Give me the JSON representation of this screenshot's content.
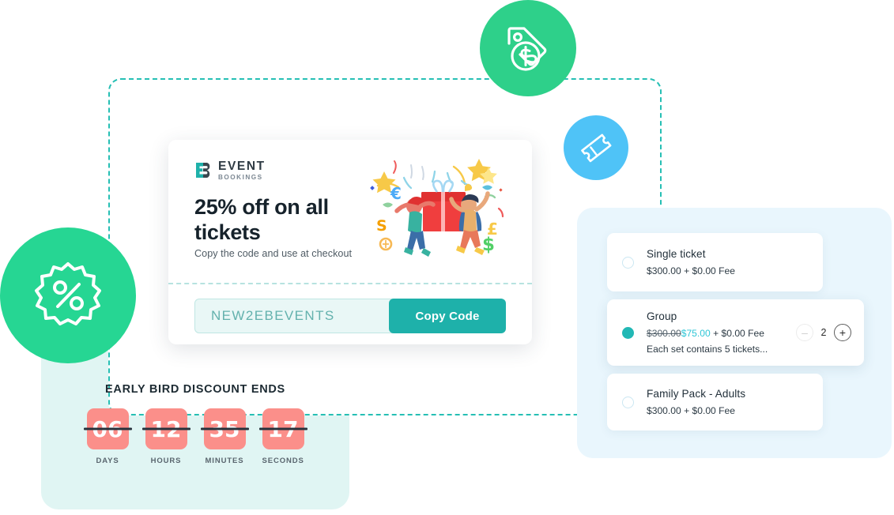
{
  "brand": {
    "logo_line1": "EVENT",
    "logo_line2": "BOOKINGS",
    "teal": "#1eb1aa",
    "green": "#26d693",
    "blue": "#4fc3f7",
    "coral": "#fb8f8a"
  },
  "coupon": {
    "headline": "25% off on all tickets",
    "subline": "Copy the code and use at checkout",
    "code": "NEW2EBEVENTS",
    "copy_button": "Copy Code",
    "illustration": "gift-celebration-illustration"
  },
  "countdown": {
    "title": "EARLY BIRD DISCOUNT ENDS",
    "units": [
      {
        "value": "06",
        "label": "DAYS"
      },
      {
        "value": "12",
        "label": "HOURS"
      },
      {
        "value": "35",
        "label": "MINUTES"
      },
      {
        "value": "17",
        "label": "SECONDS"
      }
    ]
  },
  "tickets": [
    {
      "name": "Single ticket",
      "price": "$300.00",
      "fee": "+ $0.00 Fee",
      "selected": false
    },
    {
      "name": "Group",
      "old_price": "$300.00",
      "price": "$75.00",
      "fee": "+ $0.00 Fee",
      "note": "Each set contains 5 tickets...",
      "selected": true,
      "quantity": "2",
      "minus_label": "–",
      "plus_label": "+"
    },
    {
      "name": "Family Pack - Adults",
      "price": "$300.00",
      "fee": "+ $0.00 Fee",
      "selected": false
    }
  ],
  "badges": [
    {
      "icon": "price-tag-dollar-icon",
      "color": "#2ed08a"
    },
    {
      "icon": "ticket-icon",
      "color": "#4fc3f7"
    },
    {
      "icon": "percent-badge-icon",
      "color": "#26d693"
    }
  ]
}
